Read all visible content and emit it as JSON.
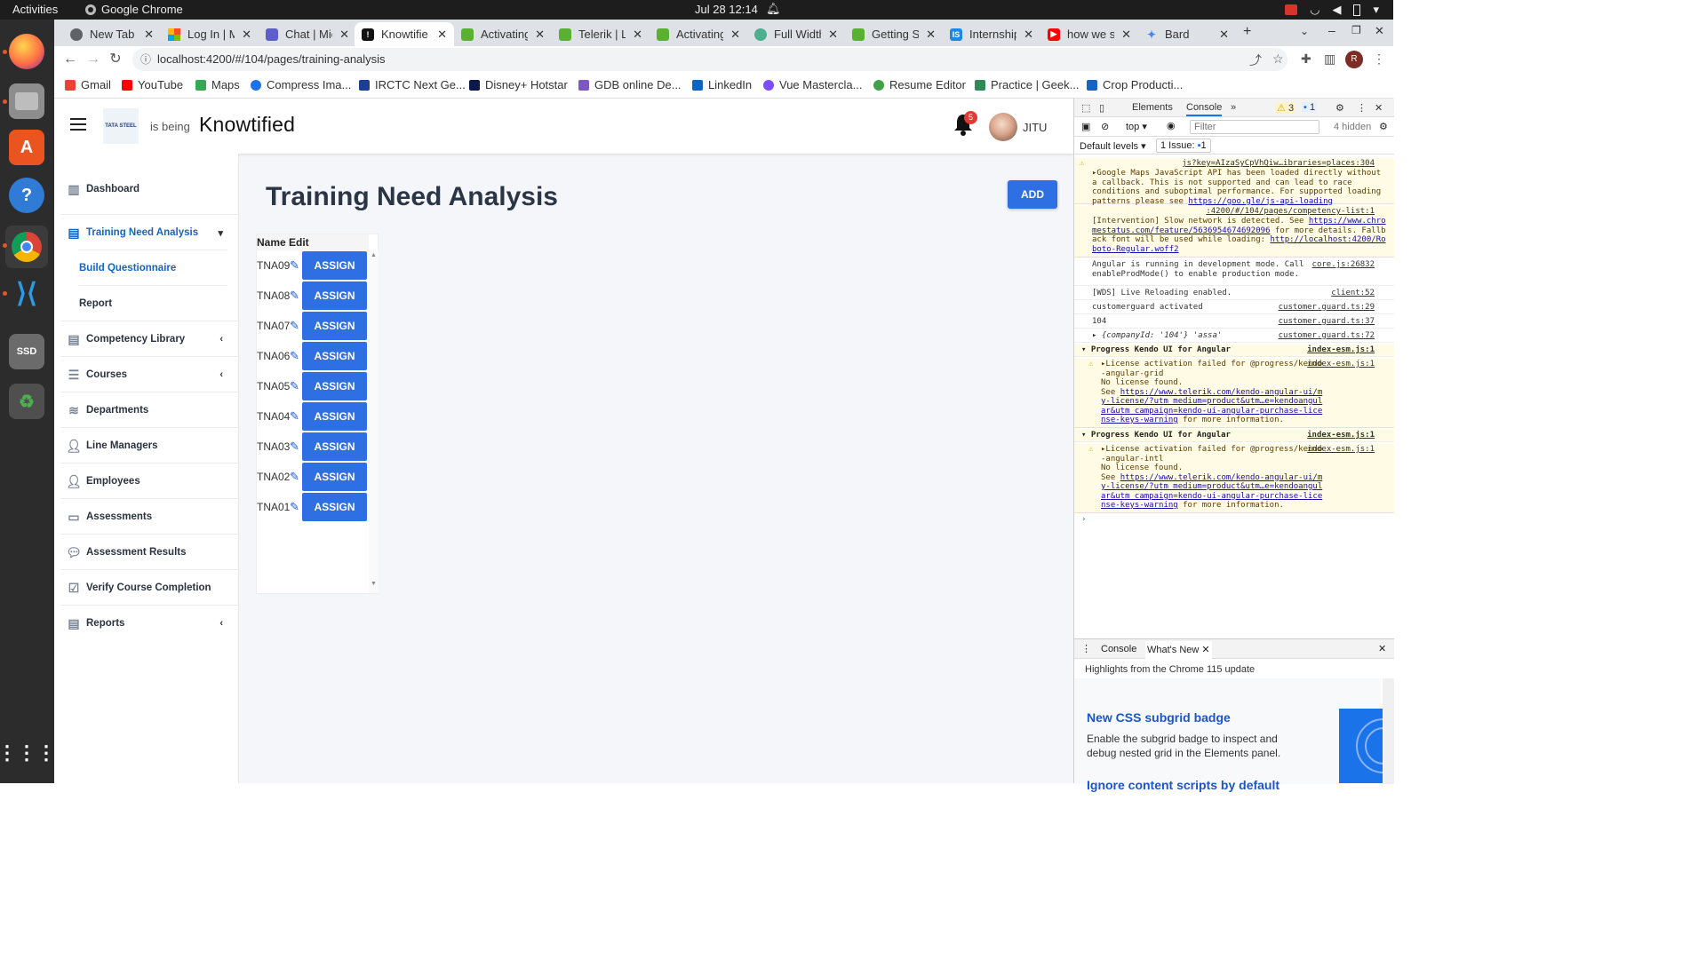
{
  "os_bar": {
    "activities": "Activities",
    "app_name": "Google Chrome",
    "clock": "Jul 28  12:14"
  },
  "dock": {
    "items": [
      "firefox",
      "files",
      "app-center",
      "help",
      "chrome",
      "vscode",
      "ssd-drive",
      "trash",
      "show-apps"
    ]
  },
  "tabs": [
    {
      "title": "New Tab",
      "color": "#5f6368"
    },
    {
      "title": "Log In | Mi",
      "color": "#f25022"
    },
    {
      "title": "Chat | Micr",
      "color": "#5b5fc7"
    },
    {
      "title": "Knowtifie",
      "color": "#111111"
    },
    {
      "title": "Activating",
      "color": "#5ab031"
    },
    {
      "title": "Telerik | Lo",
      "color": "#5ab031"
    },
    {
      "title": "Activating",
      "color": "#5ab031"
    },
    {
      "title": "Full Width",
      "color": "#4caf8f"
    },
    {
      "title": "Getting St",
      "color": "#5ab031"
    },
    {
      "title": "Internship",
      "color": "#1e88e5"
    },
    {
      "title": "how we se",
      "color": "#ff0000"
    },
    {
      "title": "Bard",
      "color": "#4285f4"
    }
  ],
  "url": "localhost:4200/#/104/pages/training-analysis",
  "bookmarks": [
    {
      "label": "Gmail",
      "color": "#ea4335"
    },
    {
      "label": "YouTube",
      "color": "#ff0000"
    },
    {
      "label": "Maps",
      "color": "#34a853"
    },
    {
      "label": "Compress Ima...",
      "color": "#1a73e8"
    },
    {
      "label": "IRCTC Next Ge...",
      "color": "#1c3f94"
    },
    {
      "label": "Disney+ Hotstar",
      "color": "#0c1a4b"
    },
    {
      "label": "GDB online De...",
      "color": "#7e57c2"
    },
    {
      "label": "LinkedIn",
      "color": "#0a66c2"
    },
    {
      "label": "Vue Mastercla...",
      "color": "#7c4dff"
    },
    {
      "label": "Resume Editor",
      "color": "#43a047"
    },
    {
      "label": "Practice | Geek...",
      "color": "#2e8b57"
    },
    {
      "label": "Crop Producti...",
      "color": "#1565c0"
    }
  ],
  "header": {
    "company_logo_text": "TATA STEEL",
    "is_being": "is being",
    "brand": "Knowtified",
    "notification_count": "5",
    "user_name": "JITU"
  },
  "sidebar": {
    "items": [
      {
        "label": "Dashboard",
        "icon": "chart-icon"
      },
      {
        "label": "Training Need Analysis",
        "icon": "document-icon",
        "active": true
      },
      {
        "label": "Build Questionnaire",
        "sub": true,
        "active": true
      },
      {
        "label": "Report",
        "sub": true
      },
      {
        "label": "Competency Library",
        "icon": "document-icon"
      },
      {
        "label": "Courses",
        "icon": "list-icon"
      },
      {
        "label": "Departments",
        "icon": "layers-icon"
      },
      {
        "label": "Line Managers",
        "icon": "person-tie-icon"
      },
      {
        "label": "Employees",
        "icon": "person-icon"
      },
      {
        "label": "Assessments",
        "icon": "chat-icon"
      },
      {
        "label": "Assessment Results",
        "icon": "comments-icon"
      },
      {
        "label": "Verify Course Completion",
        "icon": "checklist-icon"
      },
      {
        "label": "Reports",
        "icon": "report-icon"
      }
    ]
  },
  "page": {
    "title": "Training Need Analysis",
    "add_label": "ADD",
    "grid": {
      "columns": [
        "Name",
        "Edit"
      ],
      "rows": [
        {
          "name": "TNA09",
          "action": "ASSIGN"
        },
        {
          "name": "TNA08",
          "action": "ASSIGN"
        },
        {
          "name": "TNA07",
          "action": "ASSIGN"
        },
        {
          "name": "TNA06",
          "action": "ASSIGN"
        },
        {
          "name": "TNA05",
          "action": "ASSIGN"
        },
        {
          "name": "TNA04",
          "action": "ASSIGN"
        },
        {
          "name": "TNA03",
          "action": "ASSIGN"
        },
        {
          "name": "TNA02",
          "action": "ASSIGN"
        },
        {
          "name": "TNA01",
          "action": "ASSIGN"
        }
      ]
    }
  },
  "devtools": {
    "tabs": [
      "Elements",
      "Console"
    ],
    "active_tab": "Console",
    "warnings": "3",
    "infos": "1",
    "context": "top",
    "filter_placeholder": "Filter",
    "hidden": "4 hidden",
    "default_levels": "Default levels ▾",
    "issues": "1 Issue:",
    "issue_count": "1",
    "messages": [
      {
        "type": "warn",
        "text": "▸Google Maps JavaScript API has been loaded directly without a callback. This is not supported and can lead to race conditions and suboptimal performance. For supported loading patterns please see ",
        "link": "https://goo.gle/js-api-loading",
        "src": "js?key=AIzaSyCpVhQiw…ibraries=places:304"
      },
      {
        "type": "warn",
        "text": "[Intervention] Slow network is detected. See ",
        "link": "https://www.chromestatus.com/feature/5636954674692096",
        "text2": " for more details. Fallback font will be used while loading: ",
        "link2": "http://localhost:4200/Roboto-Regular.woff2",
        "src": ":4200/#/104/pages/competency-list:1"
      },
      {
        "type": "log",
        "text": "Angular is running in development mode. Call enableProdMode() to enable production mode.",
        "src": "core.js:26832"
      },
      {
        "type": "log",
        "text": "[WDS] Live Reloading enabled.",
        "src": "client:52"
      },
      {
        "type": "log",
        "text": "customerguard activated",
        "src": "customer.guard.ts:29"
      },
      {
        "type": "log",
        "text": "104",
        "src": "customer.guard.ts:37"
      },
      {
        "type": "log",
        "text": "▸ {companyId: '104'} 'assa'",
        "src": "customer.guard.ts:72"
      },
      {
        "type": "group",
        "text": "▾ Progress Kendo UI for Angular",
        "src": "index-esm.js:1"
      },
      {
        "type": "warn",
        "text": "▸License activation failed for @progress/kendo-angular-grid\nNo license found.\nSee ",
        "link": "https://www.telerik.com/kendo-angular-ui/my-license/?utm_medium=product&utm…e=kendoangular&utm_campaign=kendo-ui-angular-purchase-license-keys-warning",
        "text2": " for more information.",
        "src": "index-esm.js:1"
      },
      {
        "type": "group",
        "text": "▾ Progress Kendo UI for Angular",
        "src": "index-esm.js:1"
      },
      {
        "type": "warn",
        "text": "▸License activation failed for @progress/kendo-angular-intl\nNo license found.\nSee ",
        "link": "https://www.telerik.com/kendo-angular-ui/my-license/?utm_medium=product&utm…e=kendoangular&utm_campaign=kendo-ui-angular-purchase-license-keys-warning",
        "text2": " for more information.",
        "src": "index-esm.js:1"
      }
    ],
    "drawer_tabs": [
      "Console",
      "What's New"
    ],
    "whats_new_head": "Highlights from the Chrome 115 update",
    "whats_new_items": [
      {
        "title": "New CSS subgrid badge",
        "text": "Enable the subgrid badge to inspect and debug nested grid in the Elements panel."
      },
      {
        "title": "Ignore content scripts by default",
        "text": ""
      }
    ]
  },
  "colors": {
    "accent": "#2f6fe4",
    "active_nav": "#1565c0",
    "badge": "#e53935"
  }
}
